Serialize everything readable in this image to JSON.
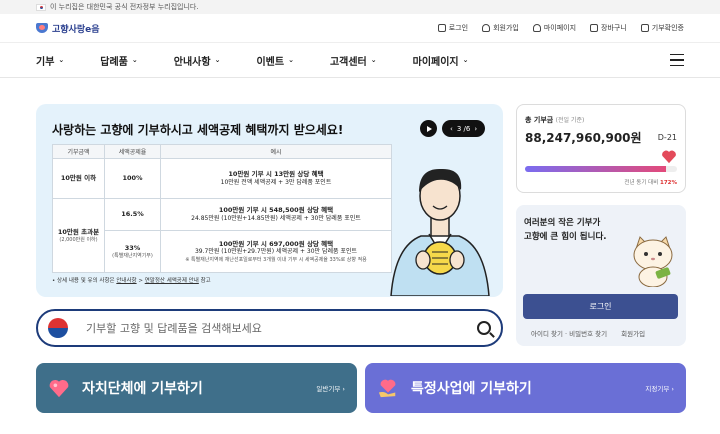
{
  "gov_banner": {
    "text": "이 누리집은 대한민국 공식 전자정부 누리집입니다."
  },
  "header": {
    "logo": "고향사랑e음",
    "utility": [
      "로그인",
      "회원가입",
      "마이페이지",
      "장바구니",
      "기부확인증"
    ]
  },
  "nav": [
    "기부",
    "답례품",
    "안내사항",
    "이벤트",
    "고객센터",
    "마이페이지"
  ],
  "hero": {
    "title": "사랑하는 고향에 기부하시고 세액공제 혜택까지 받으세요!",
    "pager": "3 /6",
    "table": {
      "headers": [
        "기부금액",
        "세액공제율",
        "예시"
      ],
      "row1": {
        "amount": "10만원 이하",
        "rate": "100%",
        "ex1": "10만원 기부 시 13만원 상당 혜택",
        "ex2": "10만원 전액 세액공제 + 3만 답례품 포인트"
      },
      "row_group": {
        "amount": "10만원 초과분",
        "amount_sub": "(2,000만원 이하)"
      },
      "row2": {
        "rate": "16.5%",
        "ex1": "100만원 기부 시 548,500원 상당 혜택",
        "ex2": "24.85만원 (10만원+14.85만원) 세액공제 + 30만 답례품 포인트"
      },
      "row3": {
        "rate": "33%",
        "rate_sub": "(특별재난지역기부)",
        "ex1": "100만원 기부 시 697,000원 상당 혜택",
        "ex2": "39.7만원 (10만원+29.7만원) 세액공제 + 30만 답례품 포인트",
        "ex3": "※ 특별재난지역에 재난선포일로부터 3개월 이내 기부 시 세액공제율 33%로 상향 적용"
      }
    },
    "note_prefix": "• 상세 내용 및 유의 사항은",
    "note_link1": "안내사항",
    "note_sep": ">",
    "note_link2": "연말정산 세액공제 안내",
    "note_suffix": "참고"
  },
  "search": {
    "placeholder": "기부할 고향 및 답례품을 검색해보세요"
  },
  "cards": [
    {
      "title": "자치단체에 기부하기",
      "sub": "일반기부 ›"
    },
    {
      "title": "특정사업에 기부하기",
      "sub": "지정기부 ›"
    }
  ],
  "total": {
    "label": "총 기부금",
    "label_sub": "(전일 기준)",
    "amount": "88,247,960,900원",
    "dday": "D-21",
    "compare_text": "전년 동기 대비",
    "compare_value": "172%",
    "progress": 0.93
  },
  "login_box": {
    "message_line1": "여러분의 작은 기부가",
    "message_line2": "고향에 큰 힘이 됩니다.",
    "button": "로그인",
    "link1": "아이디 찾기 · 비밀번호 찾기",
    "link2": "회원가입"
  },
  "colors": {
    "accent": "#3c5091",
    "hero_bg": "#e4f2fb",
    "card1": "#3f6f8a",
    "card2": "#6a6fd6"
  }
}
